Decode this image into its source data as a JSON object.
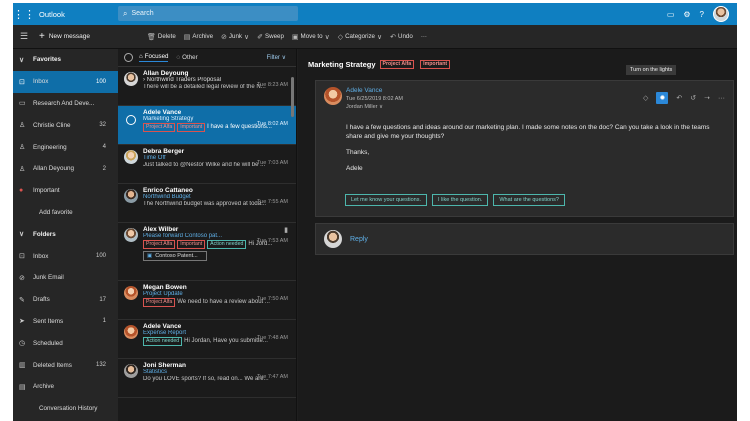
{
  "topbar": {
    "app_name": "Outlook",
    "search_placeholder": "Search"
  },
  "commands": {
    "new_message": "New message",
    "delete": "Delete",
    "archive": "Archive",
    "junk": "Junk",
    "sweep": "Sweep",
    "move_to": "Move to",
    "categorize": "Categorize",
    "undo": "Undo",
    "more": "···"
  },
  "nav": {
    "favorites": "Favorites",
    "fav_items": [
      {
        "label": "Inbox",
        "count": "100"
      },
      {
        "label": "Research And Deve..."
      },
      {
        "label": "Christie Cline",
        "count": "32"
      },
      {
        "label": "Engineering",
        "count": "4"
      },
      {
        "label": "Allan Deyoung",
        "count": "2"
      },
      {
        "label": "Important"
      }
    ],
    "add_favorite": "Add favorite",
    "folders": "Folders",
    "folder_items": [
      {
        "label": "Inbox",
        "count": "100"
      },
      {
        "label": "Junk Email"
      },
      {
        "label": "Drafts",
        "count": "17"
      },
      {
        "label": "Sent Items",
        "count": "1"
      },
      {
        "label": "Scheduled"
      },
      {
        "label": "Deleted Items",
        "count": "132"
      },
      {
        "label": "Archive"
      },
      {
        "label": "Conversation History"
      }
    ]
  },
  "list": {
    "tab_focused": "Focused",
    "tab_other": "Other",
    "filter": "Filter",
    "messages": [
      {
        "sender": "Allan Deyoung",
        "subject": "Northwind Traders Proposal",
        "time": "Tue 8:23 AM",
        "preview": "There will be a detailed legal review of the N..."
      },
      {
        "sender": "Adele Vance",
        "subject": "Marketing Strategy",
        "time": "Tue 8:02 AM",
        "tags": [
          "Project Alfa",
          "Important"
        ],
        "preview": "I have a few questions..."
      },
      {
        "sender": "Debra Berger",
        "subject": "Time Off",
        "time": "Tue 7:03 AM",
        "preview": "Just talked to @Nestor Wilke and he will be ..."
      },
      {
        "sender": "Enrico Cattaneo",
        "subject": "Northwind Budget",
        "time": "Tue 7:55 AM",
        "preview": "The Northwind budget was approved at toda..."
      },
      {
        "sender": "Alex Wilber",
        "subject": "Please forward Contoso pat...",
        "time": "Tue 7:53 AM",
        "tags": [
          "Project Alfa",
          "Important",
          "Action needed"
        ],
        "preview": "Hi Jord...",
        "attachment": "Contoso Patent..."
      },
      {
        "sender": "Megan Bowen",
        "subject": "Project Update",
        "time": "Tue 7:50 AM",
        "tags": [
          "Project Alfa"
        ],
        "preview": "We need to have a review about ..."
      },
      {
        "sender": "Adele Vance",
        "subject": "Expense Report",
        "time": "Tue 7:48 AM",
        "tags": [
          "Action needed"
        ],
        "preview": "Hi Jordan, Have you submitte..."
      },
      {
        "sender": "Joni Sherman",
        "subject": "Statistics",
        "time": "Tue 7:47 AM",
        "preview": "Do you LOVE sports? If so, read on... We are..."
      }
    ]
  },
  "reading": {
    "title": "Marketing Strategy",
    "tags": [
      "Project Alfa",
      "Important"
    ],
    "tooltip": "Turn on the lights",
    "from": "Adele Vance",
    "date": "Tue 6/25/2019 8:02 AM",
    "to": "Jordan Miller ∨",
    "body_1": "I have a few questions and ideas around our marketing plan. I made some notes on the doc? Can you take a look in the teams share and give me your thoughts?",
    "body_2": "Thanks,",
    "body_3": "Adele",
    "suggestions": [
      "Let me know your questions.",
      "I like the question.",
      "What are the questions?"
    ],
    "reply": "Reply"
  },
  "colors": {
    "brand_blue": "#0f7fc1",
    "selected": "#0f6ea8",
    "link_blue": "#5fb0e8",
    "tag_red": "#d9534f",
    "tag_teal": "#4db6ac"
  }
}
